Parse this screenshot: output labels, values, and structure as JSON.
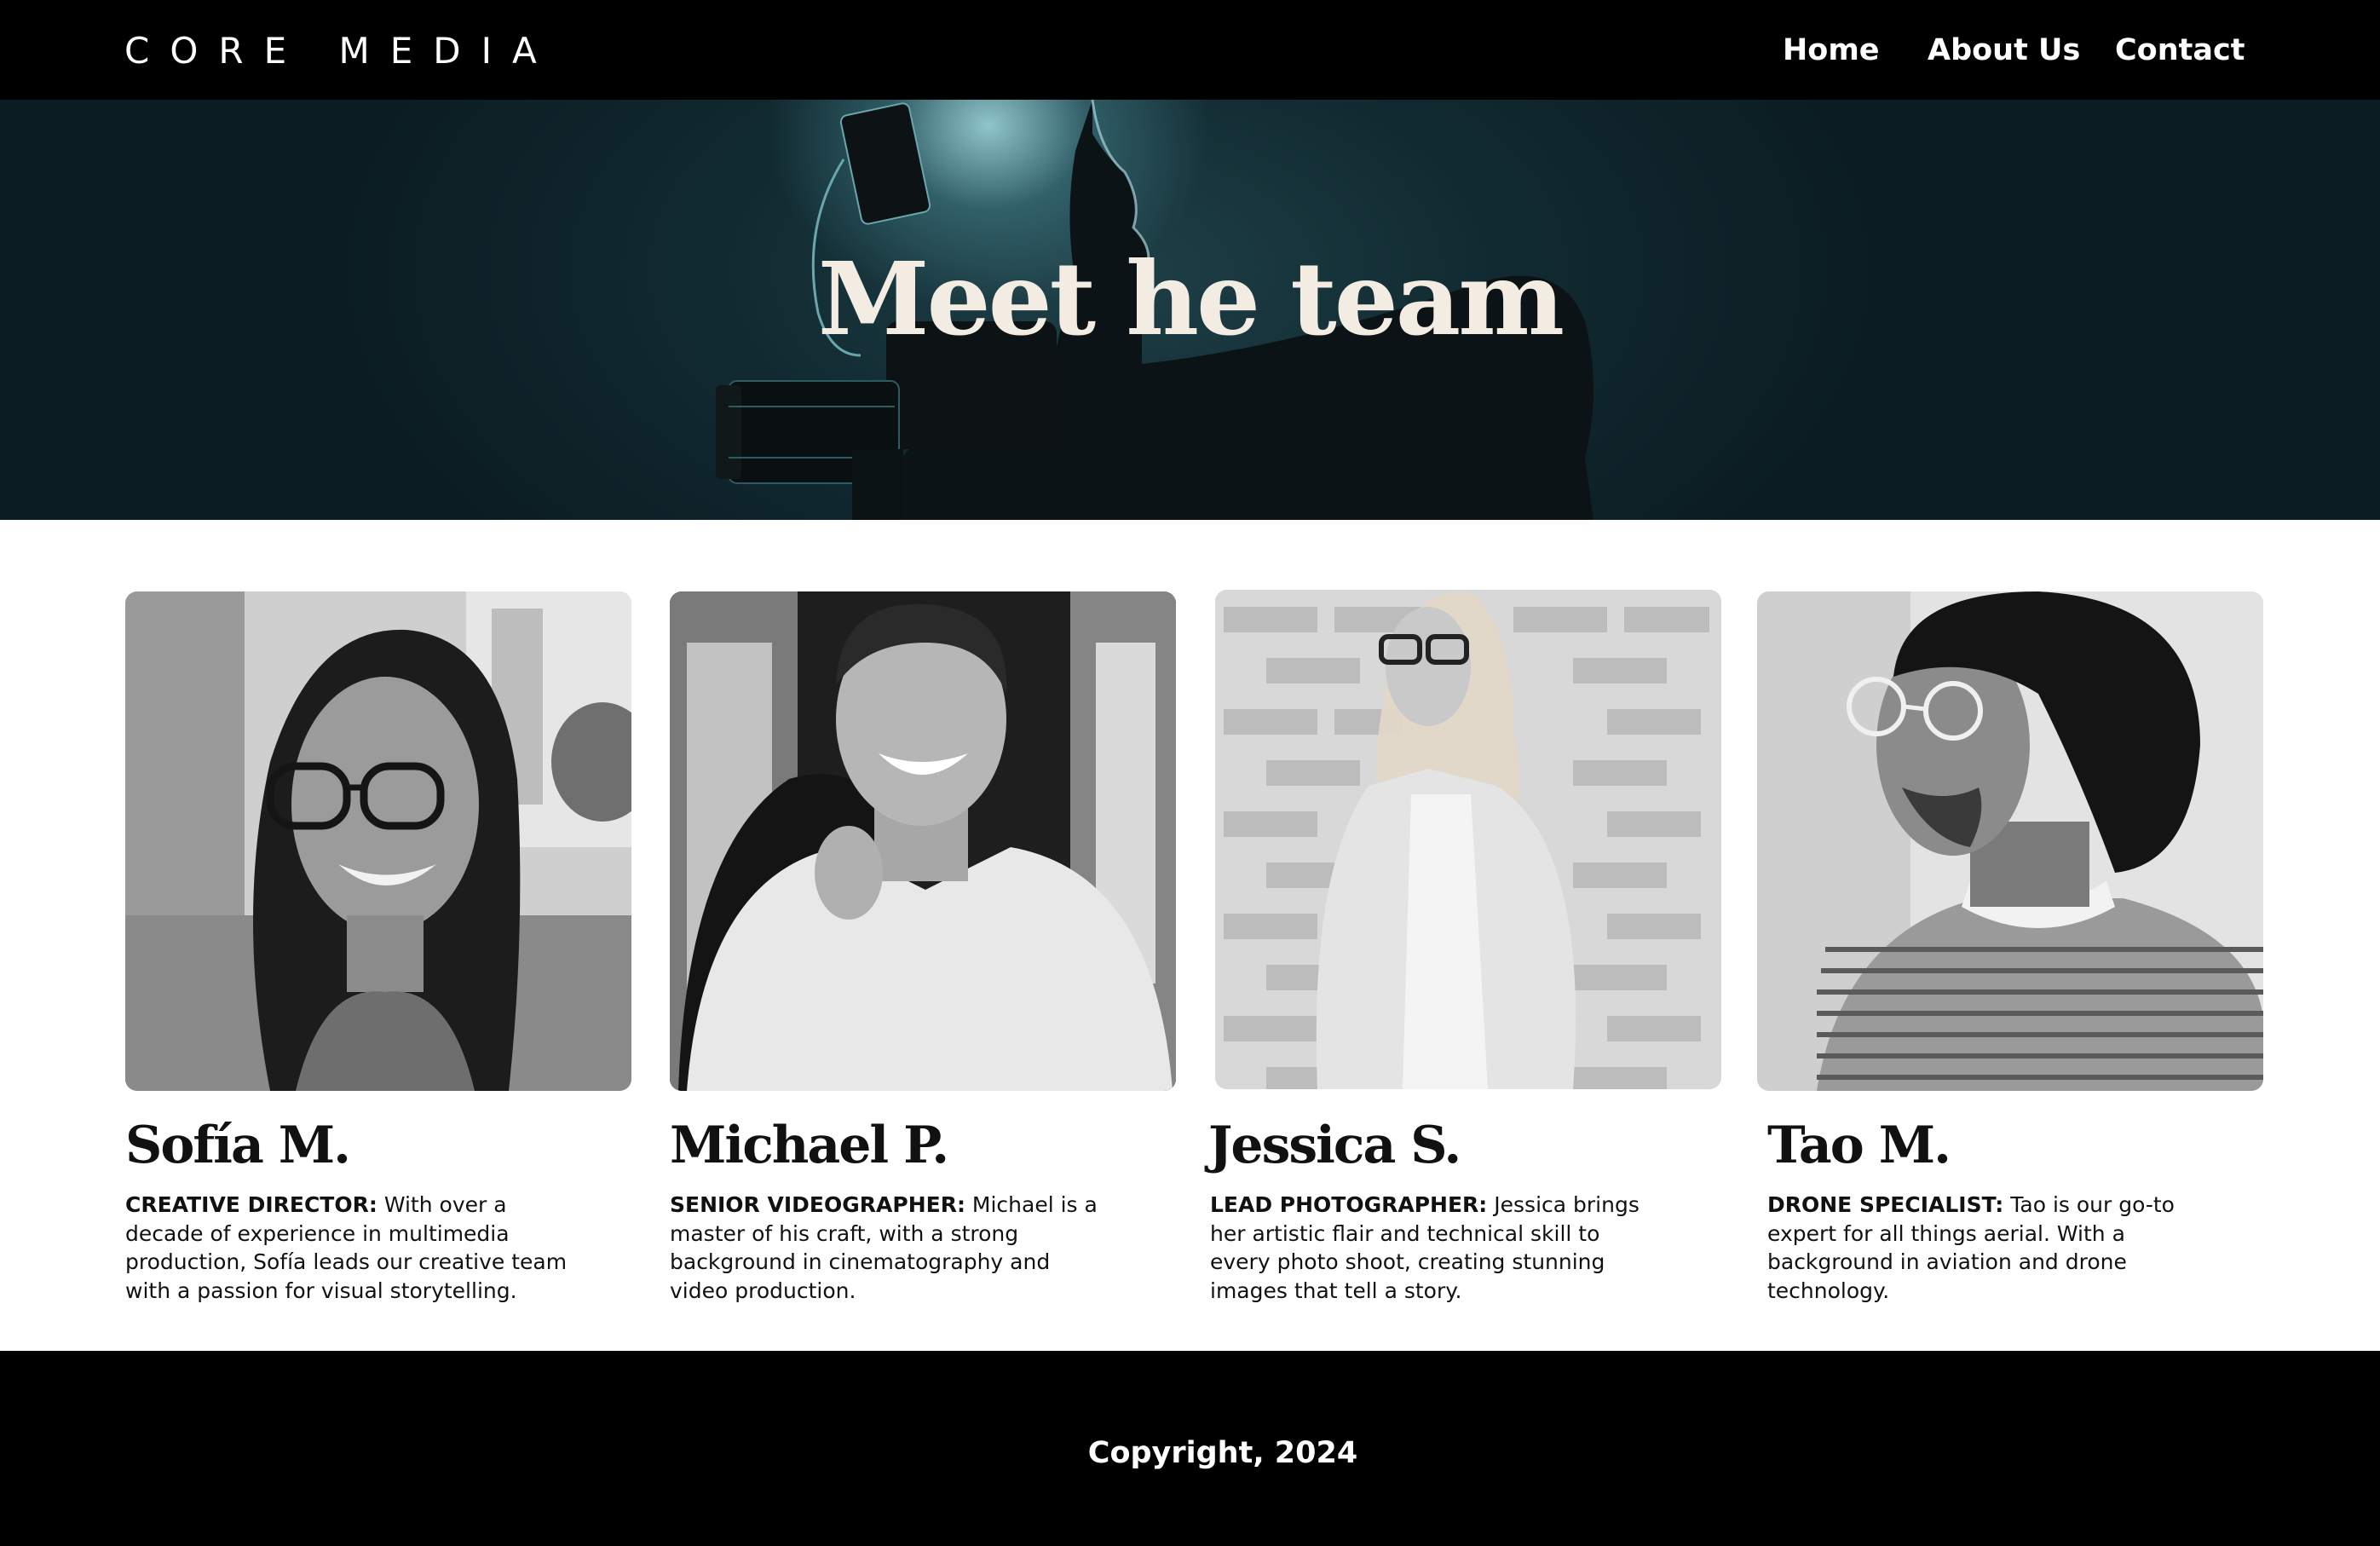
{
  "header": {
    "brand": "CORE MEDIA",
    "nav": [
      {
        "label": "Home"
      },
      {
        "label": "About Us"
      },
      {
        "label": "Contact"
      }
    ]
  },
  "hero": {
    "title": "Meet he team"
  },
  "team": [
    {
      "name": "Sofía M.",
      "role": "CREATIVE DIRECTOR:",
      "bio": "With over a decade of experience in multimedia production, Sofía leads our creative team with a passion for visual storytelling."
    },
    {
      "name": "Michael P.",
      "role": "SENIOR VIDEOGRAPHER:",
      "bio": "Michael is a master of his craft, with a strong background in cinematography and video production."
    },
    {
      "name": "Jessica S.",
      "role": "LEAD PHOTOGRAPHER:",
      "bio": "Jessica brings her artistic flair and technical skill to every photo shoot, creating stunning images that tell a story."
    },
    {
      "name": "Tao M.",
      "role": "DRONE SPECIALIST:",
      "bio": "Tao is our go-to expert for all things aerial. With a background in aviation and drone technology."
    }
  ],
  "footer": {
    "copyright": "Copyright, 2024"
  }
}
